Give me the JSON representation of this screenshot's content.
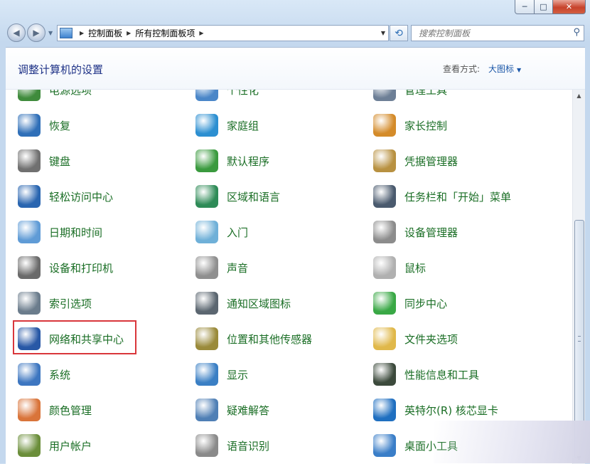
{
  "window": {
    "minimize": "─",
    "maximize": "□",
    "close": "✕"
  },
  "address": {
    "crumbs": [
      "控制面板",
      "所有控制面板项"
    ],
    "search_placeholder": "搜索控制面板"
  },
  "header": {
    "title": "调整计算机的设置",
    "view_label": "查看方式:",
    "view_value": "大图标"
  },
  "items": [
    {
      "label": "电源选项",
      "icon": "power-icon",
      "color": "#3f8b3c"
    },
    {
      "label": "个性化",
      "icon": "personalization-icon",
      "color": "#4a86c8"
    },
    {
      "label": "管理工具",
      "icon": "admin-tools-icon",
      "color": "#6d7f96"
    },
    {
      "label": "恢复",
      "icon": "recovery-icon",
      "color": "#2f6fb8"
    },
    {
      "label": "家庭组",
      "icon": "homegroup-icon",
      "color": "#2c8fd1"
    },
    {
      "label": "家长控制",
      "icon": "parental-controls-icon",
      "color": "#d48b2a"
    },
    {
      "label": "键盘",
      "icon": "keyboard-icon",
      "color": "#707070"
    },
    {
      "label": "默认程序",
      "icon": "default-programs-icon",
      "color": "#3a9a3e"
    },
    {
      "label": "凭据管理器",
      "icon": "credential-manager-icon",
      "color": "#b89141"
    },
    {
      "label": "轻松访问中心",
      "icon": "ease-of-access-icon",
      "color": "#2965b0"
    },
    {
      "label": "区域和语言",
      "icon": "region-language-icon",
      "color": "#2e8b57"
    },
    {
      "label": "任务栏和「开始」菜单",
      "icon": "taskbar-icon",
      "color": "#4a5a6e"
    },
    {
      "label": "日期和时间",
      "icon": "date-time-icon",
      "color": "#5f9bd6"
    },
    {
      "label": "入门",
      "icon": "getting-started-icon",
      "color": "#6fb0d8"
    },
    {
      "label": "设备管理器",
      "icon": "device-manager-icon",
      "color": "#8c8c8c"
    },
    {
      "label": "设备和打印机",
      "icon": "devices-printers-icon",
      "color": "#6a6a6a"
    },
    {
      "label": "声音",
      "icon": "sound-icon",
      "color": "#8f8f8f"
    },
    {
      "label": "鼠标",
      "icon": "mouse-icon",
      "color": "#b0b0b0"
    },
    {
      "label": "索引选项",
      "icon": "indexing-options-icon",
      "color": "#6b7c8c"
    },
    {
      "label": "通知区域图标",
      "icon": "notification-area-icon",
      "color": "#5b6670"
    },
    {
      "label": "同步中心",
      "icon": "sync-center-icon",
      "color": "#39a845"
    },
    {
      "label": "网络和共享中心",
      "icon": "network-sharing-icon",
      "color": "#2858a6"
    },
    {
      "label": "位置和其他传感器",
      "icon": "location-sensors-icon",
      "color": "#9a8a3a"
    },
    {
      "label": "文件夹选项",
      "icon": "folder-options-icon",
      "color": "#e0b84a"
    },
    {
      "label": "系统",
      "icon": "system-icon",
      "color": "#3d76c0"
    },
    {
      "label": "显示",
      "icon": "display-icon",
      "color": "#3a7fc4"
    },
    {
      "label": "性能信息和工具",
      "icon": "performance-icon",
      "color": "#3c4a3c"
    },
    {
      "label": "颜色管理",
      "icon": "color-management-icon",
      "color": "#d9743a"
    },
    {
      "label": "疑难解答",
      "icon": "troubleshooting-icon",
      "color": "#4f7fb5"
    },
    {
      "label": "英特尔(R) 核芯显卡",
      "icon": "intel-graphics-icon",
      "color": "#1f6fc0"
    },
    {
      "label": "用户帐户",
      "icon": "user-accounts-icon",
      "color": "#6b8e3a"
    },
    {
      "label": "语音识别",
      "icon": "speech-recognition-icon",
      "color": "#8a8a8a"
    },
    {
      "label": "桌面小工具",
      "icon": "desktop-gadgets-icon",
      "color": "#3a7ec8"
    }
  ]
}
